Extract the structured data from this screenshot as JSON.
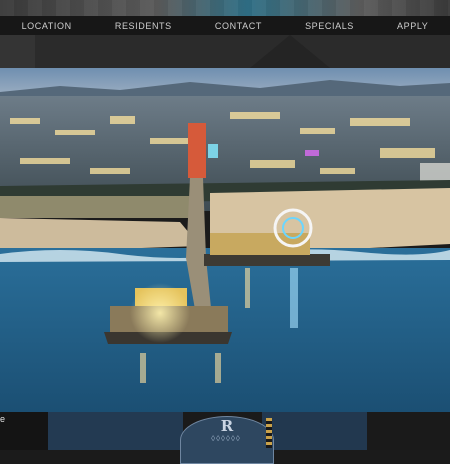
{
  "nav": {
    "items": [
      "LOCATION",
      "RESIDENTS",
      "CONTACT",
      "SPECIALS",
      "APPLY"
    ]
  },
  "photo": {
    "subject": "aerial-pier-city-dusk-icon"
  },
  "footer": {
    "badge_letter": "R",
    "caption_fragment": "e"
  },
  "colors": {
    "nav_bg": "#171717",
    "nav_text": "#cfcfcf",
    "ocean": "#1f5d86",
    "sky": "#7f9bb8"
  }
}
